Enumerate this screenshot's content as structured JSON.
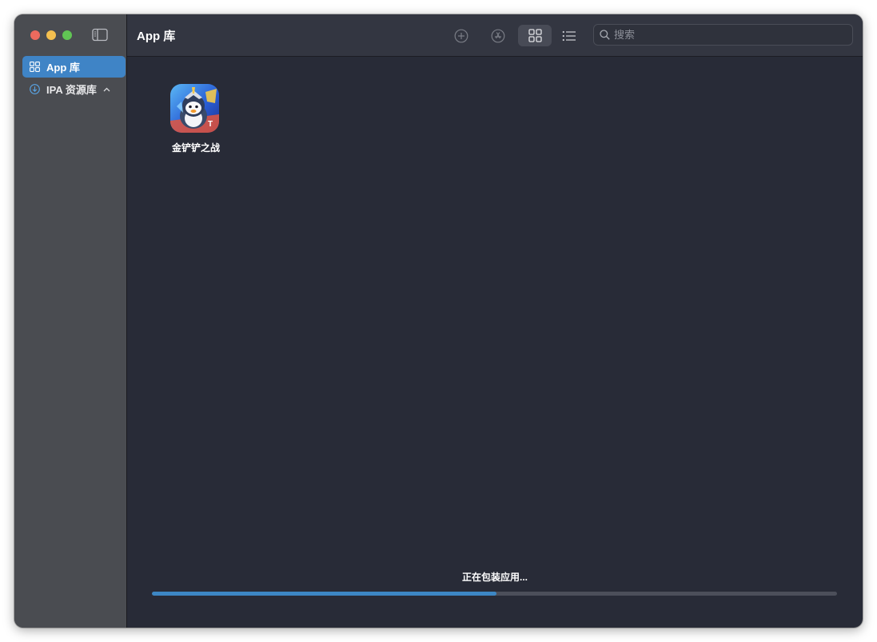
{
  "window": {
    "title": "App 库"
  },
  "sidebar": {
    "items": [
      {
        "label": "App 库",
        "icon": "grid-icon",
        "selected": true
      },
      {
        "label": "IPA 资源库",
        "icon": "download-circle-icon",
        "expanded": true
      }
    ]
  },
  "toolbar": {
    "buttons": [
      {
        "name": "add-button",
        "icon": "plus-circle-icon"
      },
      {
        "name": "install-button",
        "icon": "app-store-icon"
      },
      {
        "name": "grid-view-button",
        "icon": "grid-icon",
        "selected": true
      },
      {
        "name": "list-view-button",
        "icon": "list-icon"
      }
    ],
    "search": {
      "placeholder": "搜索",
      "value": ""
    }
  },
  "apps": [
    {
      "name": "金铲铲之战",
      "icon": "penguin-game-icon"
    }
  ],
  "status": {
    "text": "正在包装应用...",
    "progress_percent": 50.3
  },
  "colors": {
    "accent": "#3f84c6",
    "progress_fill": "#3d87c4",
    "background": "#282b37",
    "sidebar": "#4a4c51",
    "toolbar": "#333641"
  }
}
